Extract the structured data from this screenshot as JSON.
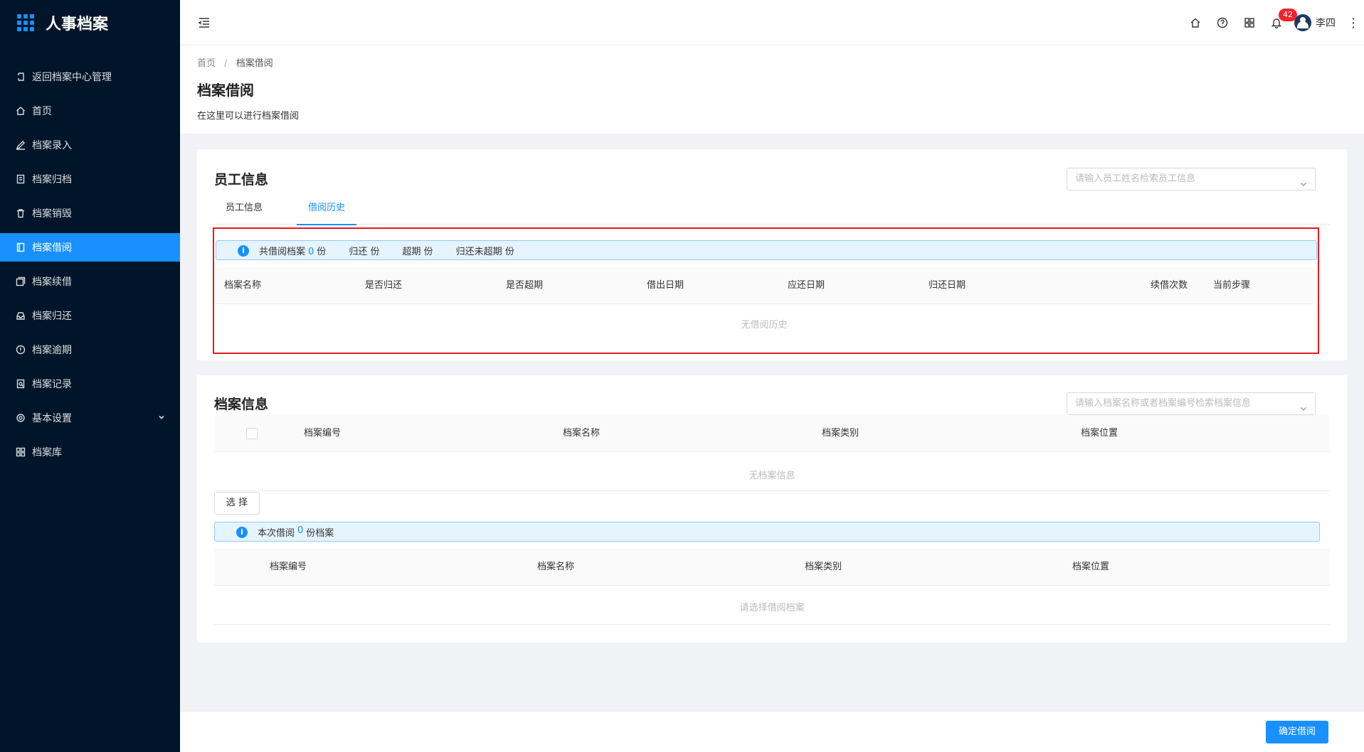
{
  "app": {
    "title": "人事档案"
  },
  "sidebar": {
    "items": [
      {
        "label": "返回档案中心管理",
        "icon": "return-icon"
      },
      {
        "label": "首页",
        "icon": "home-icon"
      },
      {
        "label": "档案录入",
        "icon": "edit-icon"
      },
      {
        "label": "档案归档",
        "icon": "archive-icon"
      },
      {
        "label": "档案销毁",
        "icon": "trash-icon"
      },
      {
        "label": "档案借阅",
        "icon": "book-icon",
        "active": true
      },
      {
        "label": "档案续借",
        "icon": "copy-icon"
      },
      {
        "label": "档案归还",
        "icon": "inbox-icon"
      },
      {
        "label": "档案逾期",
        "icon": "alert-circle-icon"
      },
      {
        "label": "档案记录",
        "icon": "record-icon"
      },
      {
        "label": "基本设置",
        "icon": "gear-icon",
        "expandable": true
      },
      {
        "label": "档案库",
        "icon": "grid-icon"
      }
    ]
  },
  "header": {
    "notifications_count": "42",
    "user_name": "李四"
  },
  "page": {
    "breadcrumb": [
      "首页",
      "/",
      "档案借阅"
    ],
    "title": "档案借阅",
    "description": "在这里可以进行档案借阅"
  },
  "employee_card": {
    "title": "员工信息",
    "search_placeholder": "请输入员工姓名检索员工信息",
    "tabs": [
      "员工信息",
      "借阅历史"
    ],
    "active_tab": "借阅历史",
    "summary": {
      "total_label": "共借阅档案",
      "total_value": "0",
      "total_unit": "份",
      "returned_label": "归还",
      "returned_unit": "份",
      "overdue_label": "超期",
      "overdue_unit": "份",
      "unreturned_label": "归还未超期",
      "unreturned_unit": "份"
    },
    "columns": [
      "档案名称",
      "是否归还",
      "是否超期",
      "借出日期",
      "应还日期",
      "归还日期",
      "续借次数",
      "当前步骤"
    ],
    "empty_text": "无借阅历史"
  },
  "archive_card": {
    "title": "档案信息",
    "search_placeholder": "请输入档案名称或者档案编号检索档案信息",
    "columns": [
      "档案编号",
      "档案名称",
      "档案类别",
      "档案位置"
    ],
    "empty_text": "无档案信息",
    "select_button": "选 择",
    "borrow_summary": {
      "prefix": "本次借阅",
      "value": "0",
      "suffix": "份档案"
    },
    "selected_columns": [
      "档案编号",
      "档案名称",
      "档案类别",
      "档案位置"
    ],
    "selected_empty_text": "请选择借阅档案"
  },
  "footer": {
    "confirm_button": "确定借阅"
  },
  "colors": {
    "primary": "#1890ff",
    "sidebar_bg": "#001529",
    "highlight": "#e41b1b",
    "badge": "#f5222d"
  }
}
